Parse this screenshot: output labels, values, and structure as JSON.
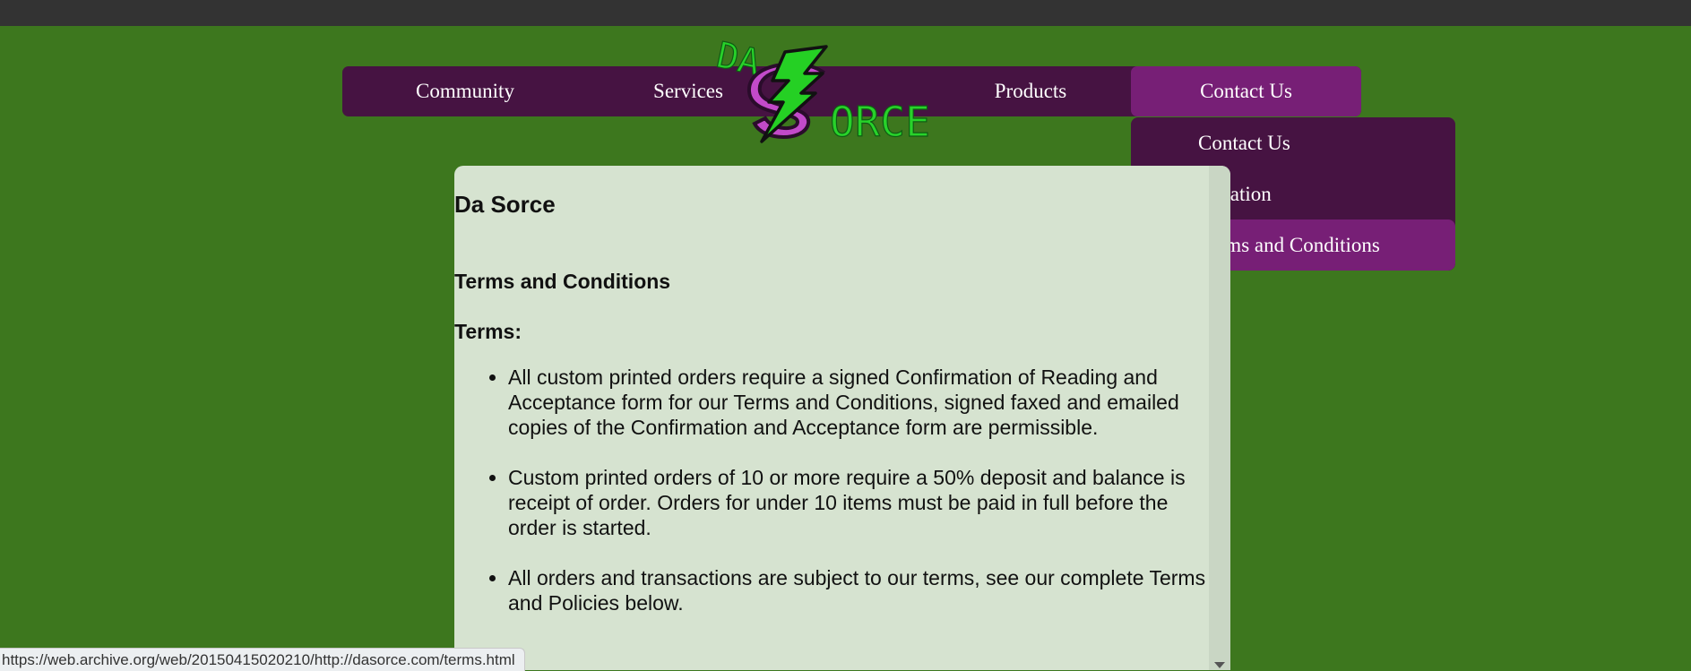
{
  "nav": {
    "items": [
      {
        "label": "Community"
      },
      {
        "label": "Services"
      },
      {
        "label": "Products"
      },
      {
        "label": "Contact Us"
      }
    ],
    "active": "Contact Us"
  },
  "logo": {
    "text_top": "DA",
    "text_bottom": "ORCE",
    "icon": "lightning-s-logo"
  },
  "dropdown": {
    "items": [
      {
        "label": "Contact Us"
      },
      {
        "label": "Location"
      },
      {
        "label": "Terms and Conditions"
      }
    ],
    "active": "Terms and Conditions"
  },
  "content": {
    "site_title": "Da Sorce",
    "section_title": "Terms and Conditions",
    "terms_heading": "Terms:",
    "terms": [
      "All custom printed orders require a signed Confirmation of Reading and Acceptance form for our Terms and Conditions, signed faxed and emailed copies of the Confirmation and Acceptance form are permissible.",
      "Custom printed orders of 10 or more require a 50% deposit and balance is receipt of order. Orders for under 10 items must be paid in full before the order is started.",
      "All orders and transactions are subject to our terms, see our complete Terms and Policies below."
    ]
  },
  "statusbar": {
    "url": "https://web.archive.org/web/20150415020210/http://dasorce.com/terms.html"
  },
  "colors": {
    "page_bg": "#3d771e",
    "nav_bg": "#461342",
    "nav_active": "#771f76",
    "content_bg": "#d6e3d0",
    "logo_green": "#28d22a",
    "logo_purple": "#c24ac9"
  }
}
